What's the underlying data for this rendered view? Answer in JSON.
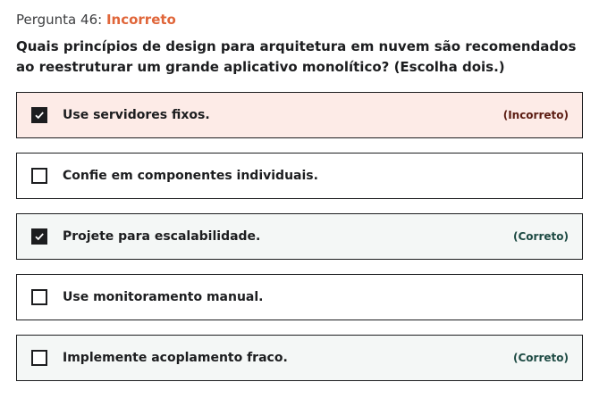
{
  "question": {
    "number_label": "Pergunta 46:",
    "status": "Incorreto",
    "text": "Quais princípios de design para arquitetura em nuvem são recomendados ao reestruturar um grande aplicativo monolítico? (Escolha dois.)"
  },
  "options": [
    {
      "label": "Use servidores fixos.",
      "checked": true,
      "verdict": "(Incorreto)"
    },
    {
      "label": "Confie em componentes individuais.",
      "checked": false,
      "verdict": ""
    },
    {
      "label": "Projete para escalabilidade.",
      "checked": true,
      "verdict": "(Correto)"
    },
    {
      "label": "Use monitoramento manual.",
      "checked": false,
      "verdict": ""
    },
    {
      "label": "Implemente acoplamento fraco.",
      "checked": false,
      "verdict": "(Correto)"
    }
  ],
  "colors": {
    "status_incorrect": "#e0663a",
    "incorrect_bg": "#fdebe7",
    "correct_bg": "#f4f7f6",
    "text": "#1c1d1f"
  }
}
